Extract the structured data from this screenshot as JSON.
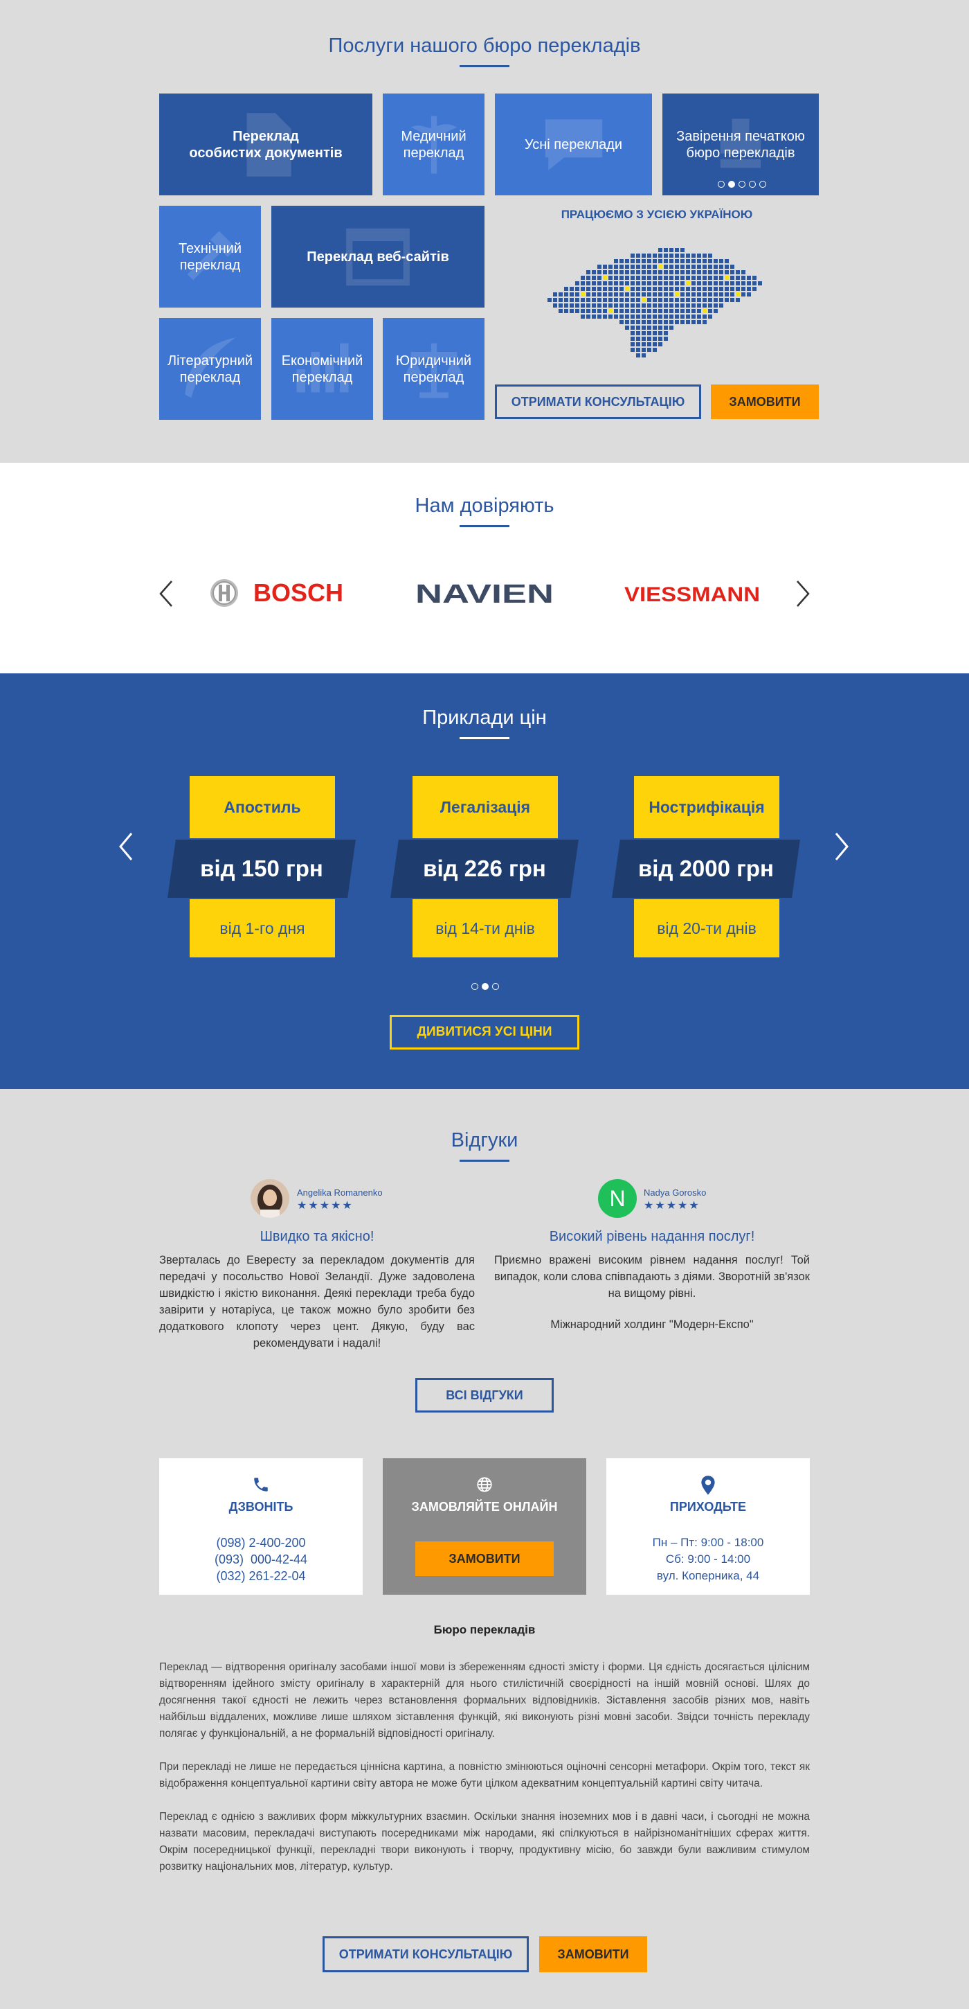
{
  "services": {
    "title": "Послуги нашого бюро перекладів",
    "tiles": [
      "Переклад\nособистих документів",
      "Медичний\nпереклад",
      "Усні переклади",
      "Завірення печаткою\nбюро перекладів",
      "Технічний\nпереклад",
      "Переклад веб-сайтів",
      "Літературний\nпереклад",
      "Економічний\nпереклад",
      "Юридичний\nпереклад"
    ],
    "slider_dots": 5,
    "slider_active": 1,
    "map_caption": "ПРАЦЮЄМО З УСІЄЮ УКРАЇНОЮ",
    "consult_label": "ОТРИМАТИ КОНСУЛЬТАЦІЮ",
    "order_label": "ЗАМОВИТИ"
  },
  "trust": {
    "title": "Нам довіряють",
    "logos": [
      "BOSCH",
      "NAVIEN",
      "VIESSMANN"
    ]
  },
  "prices": {
    "title": "Приклади цін",
    "cards": [
      {
        "name": "Апостиль",
        "price": "від 150 грн",
        "term": "від 1-го дня"
      },
      {
        "name": "Легалізація",
        "price": "від 226 грн",
        "term": "від 14-ти днів"
      },
      {
        "name": "Нострифікація",
        "price": "від 2000 грн",
        "term": "від 20-ти днів"
      }
    ],
    "slider_dots": 3,
    "slider_active": 1,
    "all_label": "ДИВИТИСЯ УСІ ЦІНИ"
  },
  "reviews": {
    "title": "Відгуки",
    "items": [
      {
        "author": "Angelika Romanenko",
        "stars": "★★★★★",
        "title": "Швидко та якісно!",
        "text": "Зверталась до Евересту за перекладом документів для передачі у посольство Нової Зеландії. Дуже задоволена швидкістю і якістю виконання. Деякі переклади треба будо завірити у нотаріуса, це також можно було зробити без додаткового клопоту через цент. Дякую, буду вас рекомендувати і надалі!",
        "sign": ""
      },
      {
        "author": "Nadya Gorosko",
        "avatar_letter": "N",
        "stars": "★★★★★",
        "title": "Високий рівень надання послуг!",
        "text": "Приємно вражені високим рівнем надання послуг! Той випадок, коли слова співпадають з діями. Зворотній зв'язок на вищому рівні.",
        "sign": "Міжнародний холдинг \"Модерн-Експо\""
      }
    ],
    "all_label": "ВСІ ВІДГУКИ"
  },
  "contacts": {
    "call": {
      "title": "ДЗВОНІТЬ",
      "lines": [
        "(098) 2-400-200",
        "(093)  000-42-44",
        "(032) 261-22-04"
      ]
    },
    "online": {
      "title": "ЗАМОВЛЯЙТЕ ОНЛАЙН",
      "button": "ЗАМОВИТИ"
    },
    "visit": {
      "title": "ПРИХОДЬТЕ",
      "lines": [
        "Пн – Пт: 9:00 - 18:00",
        "Сб: 9:00 - 14:00",
        "вул. Коперника, 44"
      ]
    }
  },
  "about": {
    "title": "Бюро перекладів",
    "paragraphs": [
      "Переклад — відтворення оригіналу засобами іншої мови із збереженням єдності змісту і форми. Ця єдність досягається цілісним відтворенням ідейного змісту оригіналу в характерній для нього стилістичній своєрідності на іншій мовній основі. Шлях до досягнення такої єдності не лежить через встановлення формальних відповідників. Зіставлення засобів різних мов, навіть найбільш віддалених, можливе лише шляхом зіставлення функцій, які виконують різні мовні засоби. Звідси точність перекладу полягає у функціональній, а не формальній відповідності оригіналу.",
      "При перекладі не лише не передається ціннісна картина, а повністю змінюються оціночні сенсорні метафори. Окрім того, текст як відображення концептуальної картини світу автора не може бути цілком адекватним концептуальній картині світу читача.",
      "Переклад є однією з важливих форм міжкультурних взаємин. Оскільки знання іноземних мов і в давні часи, і сьогодні не можна назвати масовим, перекладачі виступають посередниками між народами, які спілкуються в найрізноманітніших сферах життя. Окрім посередницької функції, перекладні твори виконують і творчу, продуктивну місію, бо завжди були важливим стимулом розвитку національних мов, літератур, культур."
    ],
    "consult_label": "ОТРИМАТИ КОНСУЛЬТАЦІЮ",
    "order_label": "ЗАМОВИТИ"
  },
  "colors": {
    "brand_blue": "#2b56a0",
    "tile_light": "#3f76d2",
    "accent_orange": "#ff9900",
    "accent_yellow": "#ffd30a",
    "price_band": "#1f3c6e"
  },
  "icons": [
    "document-icon",
    "caduceus-icon",
    "speech-bubble-icon",
    "stamp-icon",
    "tools-icon",
    "browser-window-icon",
    "feather-icon",
    "bar-chart-icon",
    "scales-icon",
    "ukraine-map-icon",
    "chevron-left-icon",
    "chevron-right-icon",
    "phone-icon",
    "globe-icon",
    "location-pin-icon"
  ]
}
